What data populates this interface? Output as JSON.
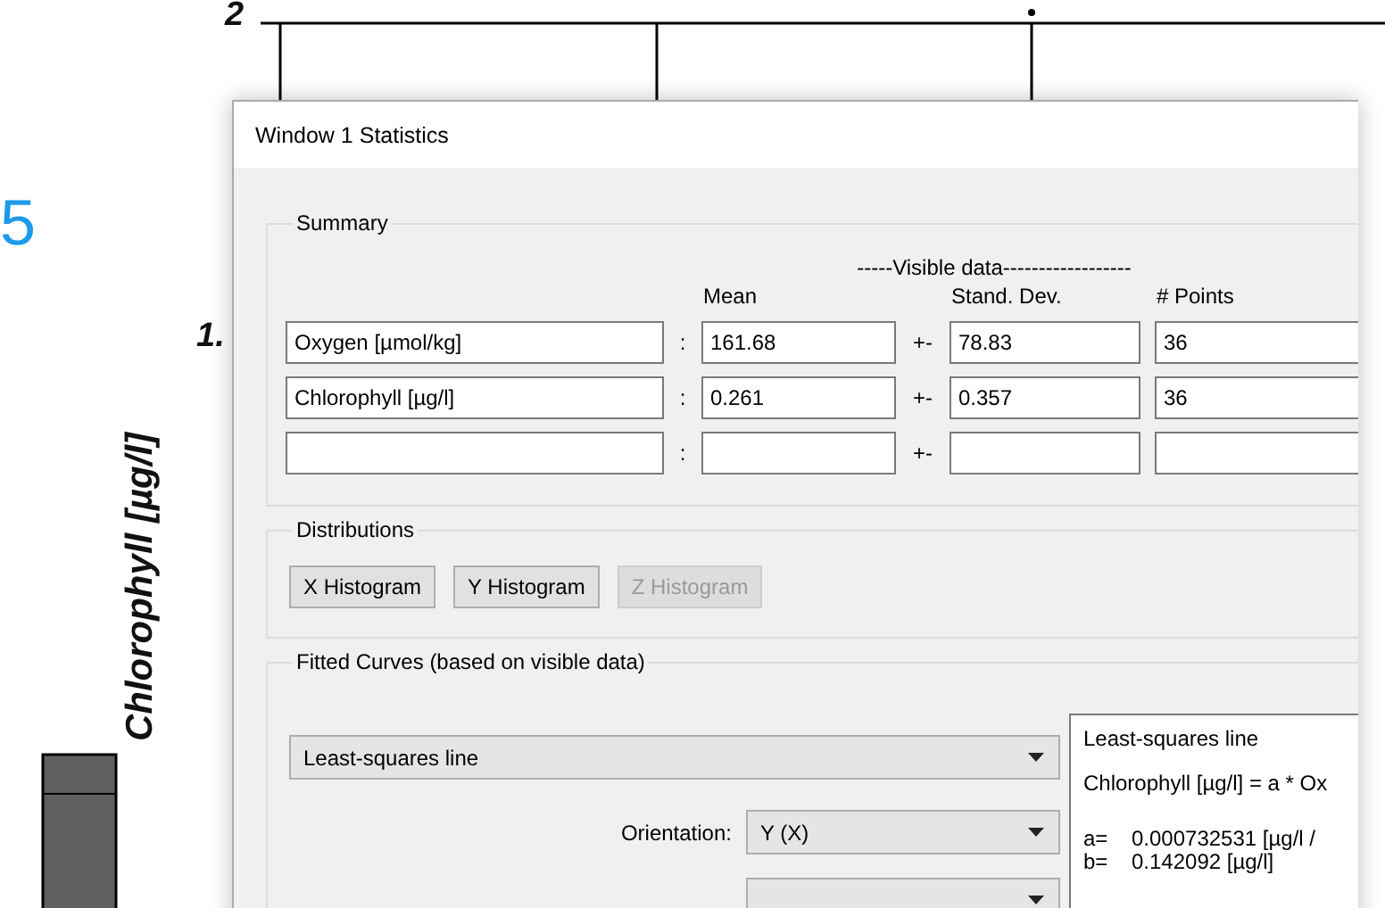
{
  "plot": {
    "side_label": "5",
    "ticks": [
      "2",
      "1."
    ],
    "axis_label": "Chlorophyll [µg/l]"
  },
  "window": {
    "title": "Window 1 Statistics"
  },
  "summary": {
    "title": "Summary",
    "header": "-----Visible data------------------",
    "columns": [
      "Mean",
      "Stand. Dev.",
      "# Points"
    ],
    "rows": [
      {
        "name": "Oxygen [µmol/kg]",
        "colon": ":",
        "mean": "161.68",
        "plusminus": "+-",
        "std": "78.83",
        "points": "36"
      },
      {
        "name": "Chlorophyll [µg/l]",
        "colon": ":",
        "mean": "0.261",
        "plusminus": "+-",
        "std": "0.357",
        "points": "36"
      },
      {
        "colon": ":",
        "plusminus": "+-"
      }
    ]
  },
  "distributions": {
    "title": "Distributions",
    "buttons": [
      {
        "label": "X Histogram",
        "disabled": false
      },
      {
        "label": "Y Histogram",
        "disabled": false
      },
      {
        "label": "Z Histogram",
        "disabled": true
      }
    ]
  },
  "fitted_curves": {
    "title": "Fitted Curves (based on visible data)",
    "method": "Least-squares line",
    "orientation": {
      "label": "Orientation:",
      "value": "Y (X)"
    },
    "result": {
      "title": "Least-squares line",
      "equation": "Chlorophyll [µg/l] = a * Ox",
      "params": [
        {
          "name": "a=",
          "value": "0.000732531 [µg/l /"
        },
        {
          "name": "b=",
          "value": "0.142092 [µg/l]"
        }
      ]
    }
  }
}
